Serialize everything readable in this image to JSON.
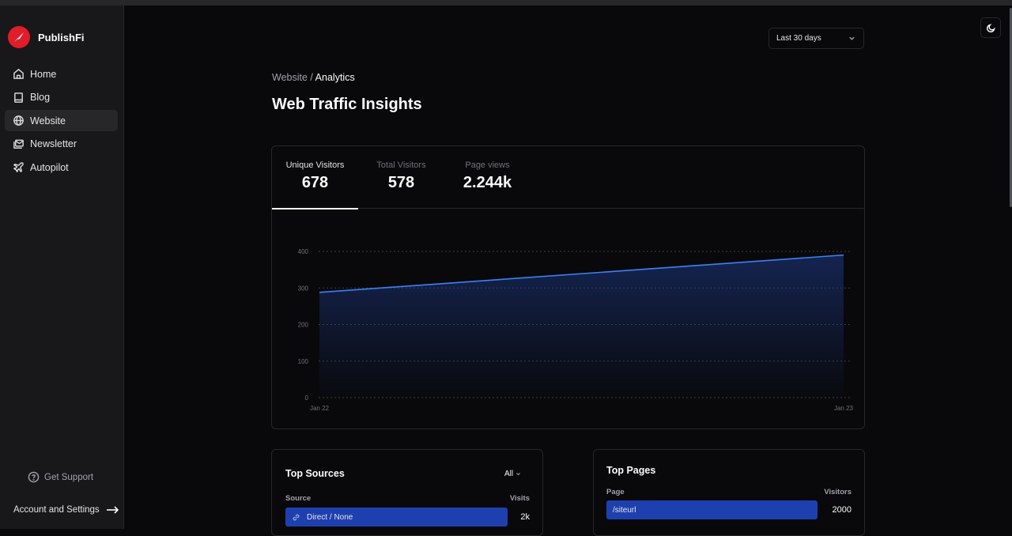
{
  "app": {
    "name": "PublishFi"
  },
  "sidebar": {
    "items": [
      {
        "label": "Home",
        "icon": "home-icon",
        "active": false
      },
      {
        "label": "Blog",
        "icon": "book-icon",
        "active": false
      },
      {
        "label": "Website",
        "icon": "globe-icon",
        "active": true
      },
      {
        "label": "Newsletter",
        "icon": "mail-icon",
        "active": false
      },
      {
        "label": "Autopilot",
        "icon": "plane-icon",
        "active": false
      }
    ],
    "support_label": "Get Support",
    "account_label": "Account and Settings"
  },
  "header": {
    "range_select": "Last 30 days",
    "theme_toggle": "moon-icon"
  },
  "breadcrumb": {
    "parent": "Website",
    "separator": " / ",
    "current": "Analytics"
  },
  "page_title": "Web Traffic Insights",
  "stats": {
    "tabs": [
      {
        "label": "Unique Visitors",
        "value": "678",
        "active": true
      },
      {
        "label": "Total Visitors",
        "value": "578",
        "active": false
      },
      {
        "label": "Page views",
        "value": "2.244k",
        "active": false
      }
    ]
  },
  "chart_data": {
    "type": "area",
    "x": [
      "Jan 22",
      "Jan 23"
    ],
    "series": [
      {
        "name": "Unique Visitors",
        "values": [
          288,
          390
        ]
      }
    ],
    "yticks": [
      0,
      100,
      200,
      300,
      400
    ],
    "ylim": [
      0,
      400
    ],
    "grid": true,
    "colors": {
      "line": "#3b82f6",
      "fill": "#1e3a8a"
    }
  },
  "top_sources": {
    "title": "Top Sources",
    "filter": "All",
    "columns": [
      "Source",
      "Visits"
    ],
    "rows": [
      {
        "label": "Direct / None",
        "value": "2k",
        "icon": "link-icon"
      }
    ]
  },
  "top_pages": {
    "title": "Top Pages",
    "columns": [
      "Page",
      "Visitors"
    ],
    "rows": [
      {
        "label": "/siteurl",
        "value": "2000"
      }
    ]
  }
}
